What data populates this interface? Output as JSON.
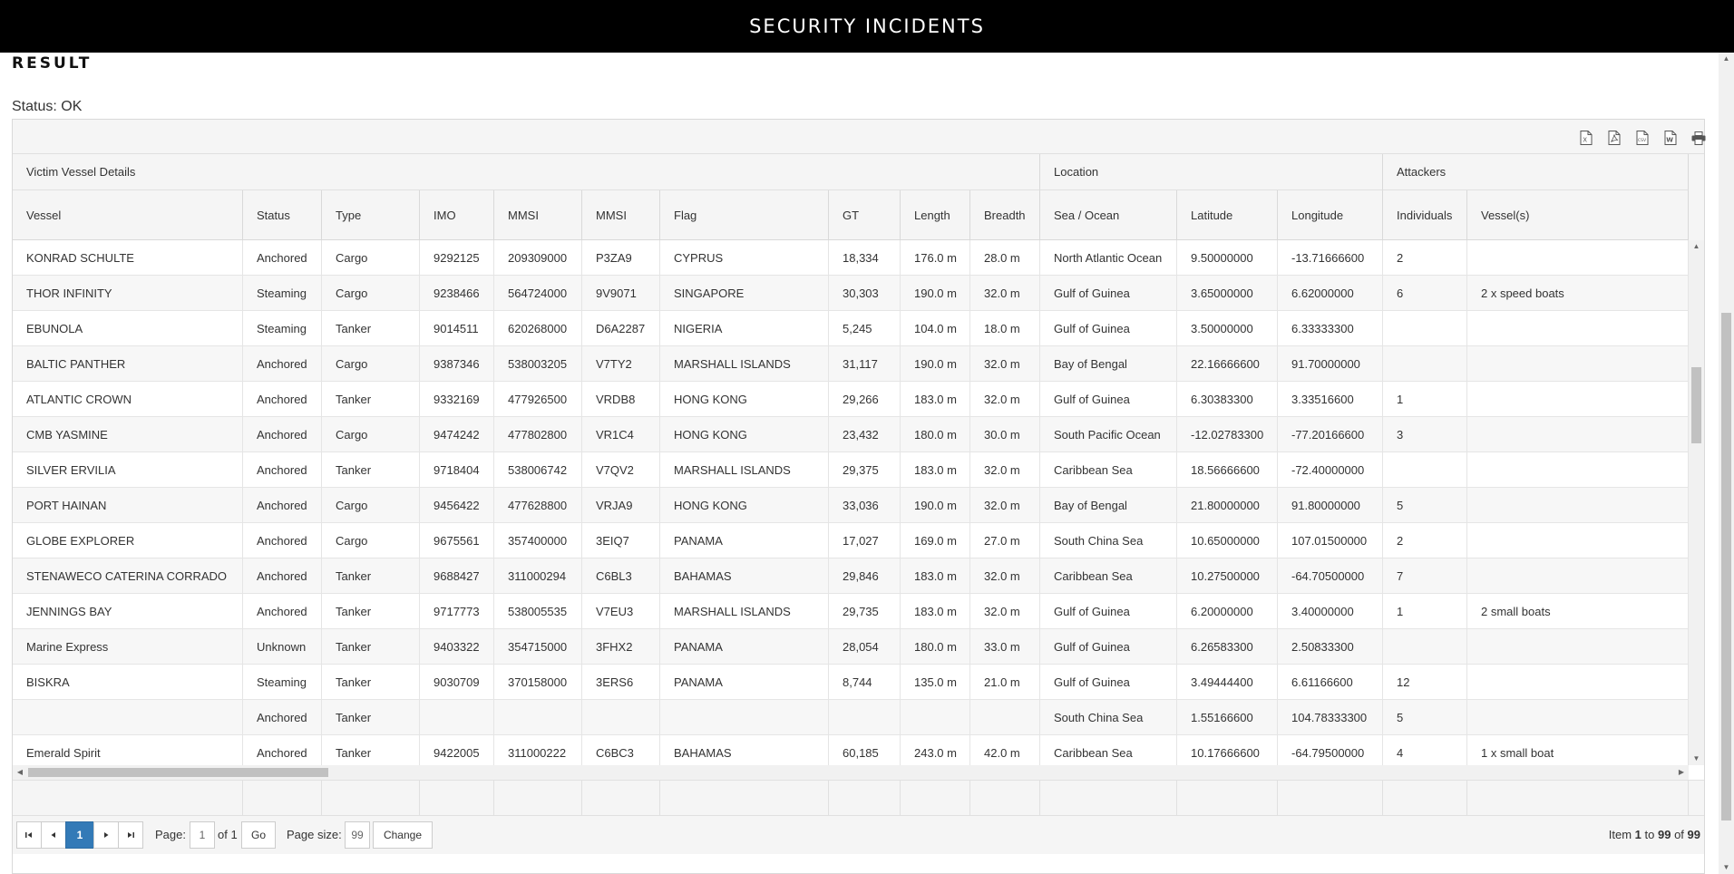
{
  "header": {
    "title": "SECURITY INCIDENTS"
  },
  "result": {
    "heading": "RESULT",
    "status": "Status: OK"
  },
  "toolbar": {
    "icons": [
      "excel-export-icon",
      "pdf-export-icon",
      "csv-export-icon",
      "word-export-icon",
      "print-icon"
    ]
  },
  "groups": {
    "victim": "Victim Vessel Details",
    "location": "Location",
    "attackers": "Attackers"
  },
  "columns": [
    "Vessel",
    "Status",
    "Type",
    "IMO",
    "MMSI",
    "MMSI",
    "Flag",
    "GT",
    "Length",
    "Breadth",
    "Sea / Ocean",
    "Latitude",
    "Longitude",
    "Individuals",
    "Vessel(s)"
  ],
  "rows": [
    [
      "KONRAD SCHULTE",
      "Anchored",
      "Cargo",
      "9292125",
      "209309000",
      "P3ZA9",
      "CYPRUS",
      "18,334",
      "176.0 m",
      "28.0 m",
      "North Atlantic Ocean",
      "9.50000000",
      "-13.71666600",
      "2",
      ""
    ],
    [
      "THOR INFINITY",
      "Steaming",
      "Cargo",
      "9238466",
      "564724000",
      "9V9071",
      "SINGAPORE",
      "30,303",
      "190.0 m",
      "32.0 m",
      "Gulf of Guinea",
      "3.65000000",
      "6.62000000",
      "6",
      "2 x speed boats"
    ],
    [
      "EBUNOLA",
      "Steaming",
      "Tanker",
      "9014511",
      "620268000",
      "D6A2287",
      "NIGERIA",
      "5,245",
      "104.0 m",
      "18.0 m",
      "Gulf of Guinea",
      "3.50000000",
      "6.33333300",
      "",
      ""
    ],
    [
      "BALTIC PANTHER",
      "Anchored",
      "Cargo",
      "9387346",
      "538003205",
      "V7TY2",
      "MARSHALL ISLANDS",
      "31,117",
      "190.0 m",
      "32.0 m",
      "Bay of Bengal",
      "22.16666600",
      "91.70000000",
      "",
      ""
    ],
    [
      "ATLANTIC CROWN",
      "Anchored",
      "Tanker",
      "9332169",
      "477926500",
      "VRDB8",
      "HONG KONG",
      "29,266",
      "183.0 m",
      "32.0 m",
      "Gulf of Guinea",
      "6.30383300",
      "3.33516600",
      "1",
      ""
    ],
    [
      "CMB YASMINE",
      "Anchored",
      "Cargo",
      "9474242",
      "477802800",
      "VR1C4",
      "HONG KONG",
      "23,432",
      "180.0 m",
      "30.0 m",
      "South Pacific Ocean",
      "-12.02783300",
      "-77.20166600",
      "3",
      ""
    ],
    [
      "SILVER ERVILIA",
      "Anchored",
      "Tanker",
      "9718404",
      "538006742",
      "V7QV2",
      "MARSHALL ISLANDS",
      "29,375",
      "183.0 m",
      "32.0 m",
      "Caribbean Sea",
      "18.56666600",
      "-72.40000000",
      "",
      ""
    ],
    [
      "PORT HAINAN",
      "Anchored",
      "Cargo",
      "9456422",
      "477628800",
      "VRJA9",
      "HONG KONG",
      "33,036",
      "190.0 m",
      "32.0 m",
      "Bay of Bengal",
      "21.80000000",
      "91.80000000",
      "5",
      ""
    ],
    [
      "GLOBE EXPLORER",
      "Anchored",
      "Cargo",
      "9675561",
      "357400000",
      "3EIQ7",
      "PANAMA",
      "17,027",
      "169.0 m",
      "27.0 m",
      "South China Sea",
      "10.65000000",
      "107.01500000",
      "2",
      ""
    ],
    [
      "STENAWECO CATERINA CORRADO",
      "Anchored",
      "Tanker",
      "9688427",
      "311000294",
      "C6BL3",
      "BAHAMAS",
      "29,846",
      "183.0 m",
      "32.0 m",
      "Caribbean Sea",
      "10.27500000",
      "-64.70500000",
      "7",
      ""
    ],
    [
      "JENNINGS BAY",
      "Anchored",
      "Tanker",
      "9717773",
      "538005535",
      "V7EU3",
      "MARSHALL ISLANDS",
      "29,735",
      "183.0 m",
      "32.0 m",
      "Gulf of Guinea",
      "6.20000000",
      "3.40000000",
      "1",
      "2 small boats"
    ],
    [
      "Marine Express",
      "Unknown",
      "Tanker",
      "9403322",
      "354715000",
      "3FHX2",
      "PANAMA",
      "28,054",
      "180.0 m",
      "33.0 m",
      "Gulf of Guinea",
      "6.26583300",
      "2.50833300",
      "",
      ""
    ],
    [
      "BISKRA",
      "Steaming",
      "Tanker",
      "9030709",
      "370158000",
      "3ERS6",
      "PANAMA",
      "8,744",
      "135.0 m",
      "21.0 m",
      "Gulf of Guinea",
      "3.49444400",
      "6.61166600",
      "12",
      ""
    ],
    [
      "",
      "Anchored",
      "Tanker",
      "",
      "",
      "",
      "",
      "",
      "",
      "",
      "South China Sea",
      "1.55166600",
      "104.78333300",
      "5",
      ""
    ],
    [
      "Emerald Spirit",
      "Anchored",
      "Tanker",
      "9422005",
      "311000222",
      "C6BC3",
      "BAHAMAS",
      "60,185",
      "243.0 m",
      "42.0 m",
      "Caribbean Sea",
      "10.17666600",
      "-64.79500000",
      "4",
      "1 x small boat"
    ]
  ],
  "pager": {
    "current_page": "1",
    "page_label": "Page:",
    "page_input": "1",
    "of_label": "of 1",
    "go_label": "Go",
    "page_size_label": "Page size:",
    "page_size_value": "99",
    "change_label": "Change",
    "info_prefix": "Item ",
    "info_from": "1",
    "info_to_word": " to ",
    "info_to": "99",
    "info_of_word": " of ",
    "info_total": "99"
  }
}
